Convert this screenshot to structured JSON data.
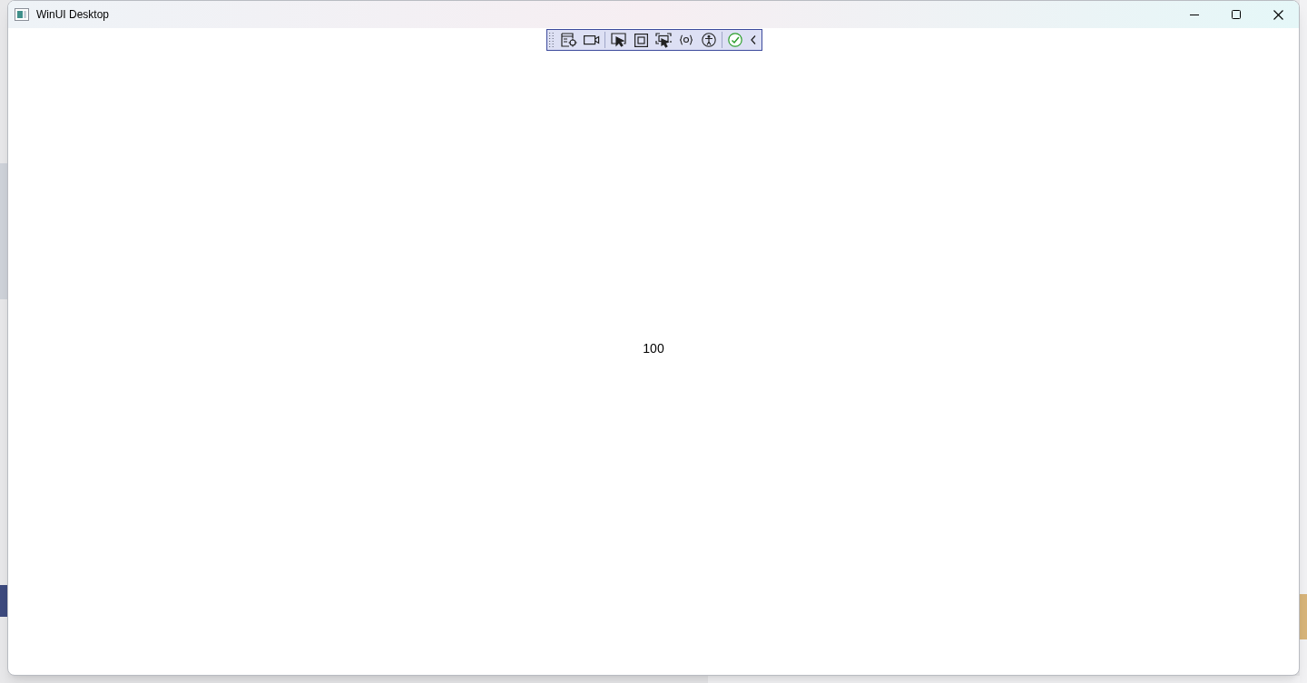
{
  "window": {
    "title": "WinUI Desktop"
  },
  "content": {
    "value": "100"
  }
}
